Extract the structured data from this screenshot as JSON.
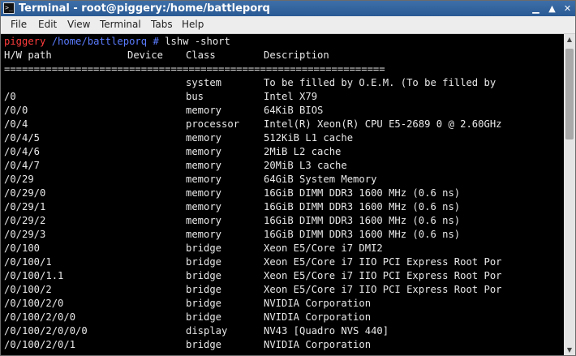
{
  "window": {
    "title": "Terminal - root@piggery:/home/battleporq",
    "icon": "terminal-icon",
    "minimize_icon": "▁",
    "maximize_icon": "▲",
    "close_icon": "✕"
  },
  "menubar": {
    "items": [
      "File",
      "Edit",
      "View",
      "Terminal",
      "Tabs",
      "Help"
    ]
  },
  "terminal": {
    "prompt": {
      "host": "piggery",
      "path": " /home/battleporq",
      "symbol": " # ",
      "command": "lshw -short"
    },
    "header": {
      "path": "H/W path",
      "device": "Device",
      "class": "Class",
      "description": "Description"
    },
    "separator": "================================================================",
    "rows": [
      {
        "path": "",
        "device": "",
        "class": "system",
        "description": "To be filled by O.E.M. (To be filled by"
      },
      {
        "path": "/0",
        "device": "",
        "class": "bus",
        "description": "Intel X79"
      },
      {
        "path": "/0/0",
        "device": "",
        "class": "memory",
        "description": "64KiB BIOS"
      },
      {
        "path": "/0/4",
        "device": "",
        "class": "processor",
        "description": "Intel(R) Xeon(R) CPU E5-2689 0 @ 2.60GHz"
      },
      {
        "path": "/0/4/5",
        "device": "",
        "class": "memory",
        "description": "512KiB L1 cache"
      },
      {
        "path": "/0/4/6",
        "device": "",
        "class": "memory",
        "description": "2MiB L2 cache"
      },
      {
        "path": "/0/4/7",
        "device": "",
        "class": "memory",
        "description": "20MiB L3 cache"
      },
      {
        "path": "/0/29",
        "device": "",
        "class": "memory",
        "description": "64GiB System Memory"
      },
      {
        "path": "/0/29/0",
        "device": "",
        "class": "memory",
        "description": "16GiB DIMM DDR3 1600 MHz (0.6 ns)"
      },
      {
        "path": "/0/29/1",
        "device": "",
        "class": "memory",
        "description": "16GiB DIMM DDR3 1600 MHz (0.6 ns)"
      },
      {
        "path": "/0/29/2",
        "device": "",
        "class": "memory",
        "description": "16GiB DIMM DDR3 1600 MHz (0.6 ns)"
      },
      {
        "path": "/0/29/3",
        "device": "",
        "class": "memory",
        "description": "16GiB DIMM DDR3 1600 MHz (0.6 ns)"
      },
      {
        "path": "/0/100",
        "device": "",
        "class": "bridge",
        "description": "Xeon E5/Core i7 DMI2"
      },
      {
        "path": "/0/100/1",
        "device": "",
        "class": "bridge",
        "description": "Xeon E5/Core i7 IIO PCI Express Root Por"
      },
      {
        "path": "/0/100/1.1",
        "device": "",
        "class": "bridge",
        "description": "Xeon E5/Core i7 IIO PCI Express Root Por"
      },
      {
        "path": "/0/100/2",
        "device": "",
        "class": "bridge",
        "description": "Xeon E5/Core i7 IIO PCI Express Root Por"
      },
      {
        "path": "/0/100/2/0",
        "device": "",
        "class": "bridge",
        "description": "NVIDIA Corporation"
      },
      {
        "path": "/0/100/2/0/0",
        "device": "",
        "class": "bridge",
        "description": "NVIDIA Corporation"
      },
      {
        "path": "/0/100/2/0/0/0",
        "device": "",
        "class": "display",
        "description": "NV43 [Quadro NVS 440]"
      },
      {
        "path": "/0/100/2/0/1",
        "device": "",
        "class": "bridge",
        "description": "NVIDIA Corporation"
      }
    ]
  },
  "scrollbar": {
    "up_icon": "▲",
    "down_icon": "▼"
  },
  "colors": {
    "titlebar": "#2f60a0",
    "prompt_host": "#ff3b3b",
    "prompt_path": "#5b7cff",
    "terminal_bg": "#000000",
    "terminal_fg": "#e8e8e8"
  }
}
